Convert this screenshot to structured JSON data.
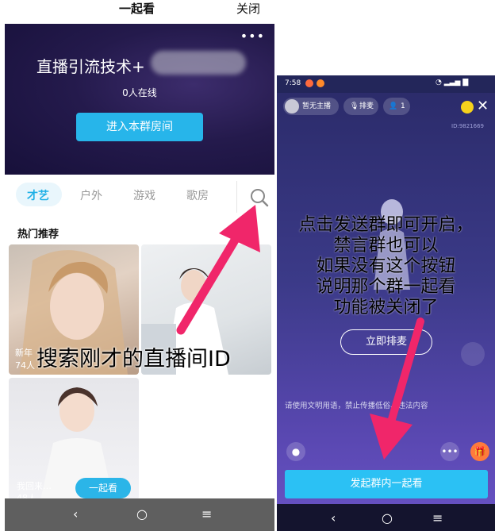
{
  "left": {
    "header": {
      "title": "一起看",
      "close_label": "关闭"
    },
    "banner": {
      "more_label": "•••",
      "room_title": "直播引流技术+",
      "online_text": "0人在线",
      "enter_button": "进入本群房间"
    },
    "tabs": [
      "才艺",
      "户外",
      "游戏",
      "歌房"
    ],
    "section_title": "热门推荐",
    "cards": [
      {
        "line1": "新年",
        "line2": "74人"
      },
      {
        "line1": "",
        "line2": ""
      },
      {
        "line1": "我回来…",
        "line2": "48人",
        "button": "一起看"
      }
    ],
    "overlay_caption": "搜索刚才的直播间ID",
    "nav": {
      "back": "‹",
      "home": "○",
      "menu": "≡"
    }
  },
  "right": {
    "status_time": "7:58",
    "host_label": "暂无主播",
    "mic_label": "排麦",
    "viewer_count": "1",
    "room_id_text": "ID:9821669",
    "overlay_lines": [
      "点击发送群即可开启，",
      "禁言群也可以",
      "如果没有这个按钮",
      "说明那个群一起看",
      "功能被关闭了"
    ],
    "join_button": "立即排麦",
    "notice": "请使用文明用语，禁止传播低俗、违法内容",
    "start_button": "发起群内一起看",
    "nav": {
      "back": "‹",
      "home": "○",
      "menu": "≡"
    }
  },
  "colors": {
    "accent": "#1fb0e6",
    "arrow": "#f0266a",
    "banner_bg": "#241a4c"
  }
}
